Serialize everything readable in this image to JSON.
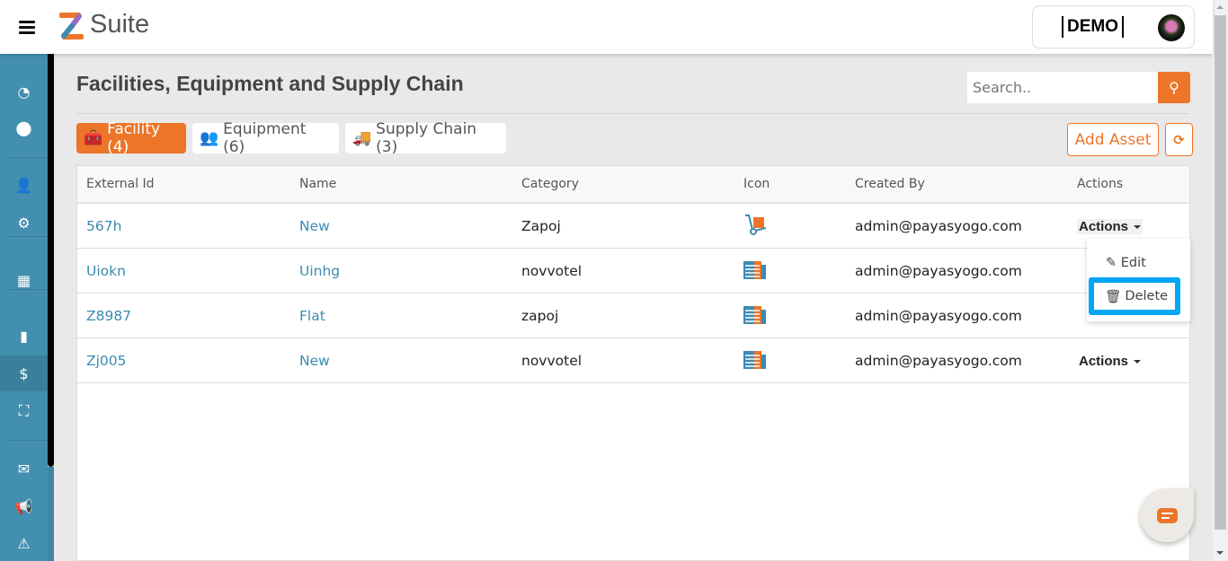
{
  "header": {
    "brand": "Suite",
    "demo_label": "DEMO"
  },
  "page": {
    "title": "Facilities, Equipment and Supply Chain"
  },
  "search": {
    "placeholder": "Search.."
  },
  "tabs": [
    {
      "label": "Facility (4)",
      "active": true
    },
    {
      "label": "Equipment (6)"
    },
    {
      "label": "Supply Chain (3)"
    }
  ],
  "toolbar": {
    "add_asset": "Add Asset"
  },
  "table": {
    "columns": [
      "External Id",
      "Name",
      "Category",
      "Icon",
      "Created By",
      "Actions"
    ],
    "rows": [
      {
        "external_id": "567h",
        "name": "New",
        "category": "Zapoj",
        "icon": "hand-truck-icon",
        "created_by": "admin@payasyogo.com",
        "actions": "Actions"
      },
      {
        "external_id": "Uiokn",
        "name": "Uinhg",
        "category": "novvotel",
        "icon": "building-icon",
        "created_by": "admin@payasyogo.com",
        "actions": ""
      },
      {
        "external_id": "Z8987",
        "name": "Flat",
        "category": "zapoj",
        "icon": "building-icon",
        "created_by": "admin@payasyogo.com",
        "actions": ""
      },
      {
        "external_id": "Zj005",
        "name": "New",
        "category": "novvotel",
        "icon": "building-icon",
        "created_by": "admin@payasyogo.com",
        "actions": "Actions"
      }
    ]
  },
  "actions_menu": {
    "edit": "Edit",
    "delete": "Delete"
  },
  "colors": {
    "accent": "#ec7529",
    "sidebar": "#438fb0",
    "link": "#3b8bb2",
    "highlight": "#00a6f5"
  }
}
